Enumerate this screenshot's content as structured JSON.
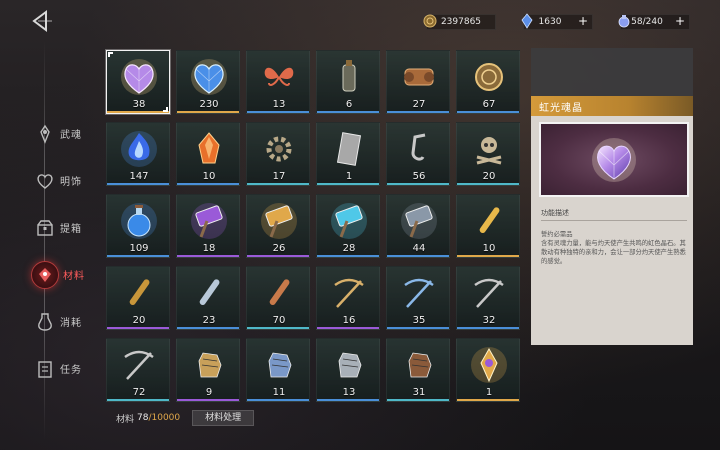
{
  "resources": [
    {
      "icon": "gold-coin-icon",
      "value": "2397865",
      "has_plus": false
    },
    {
      "icon": "blue-crystal-icon",
      "value": "1630",
      "has_plus": true
    },
    {
      "icon": "stamina-potion-icon",
      "value": "58/240",
      "has_plus": true
    }
  ],
  "menu": [
    {
      "label": "武魂",
      "icon": "spirit-icon",
      "active": false
    },
    {
      "label": "明饰",
      "icon": "heart-ornament-icon",
      "active": false
    },
    {
      "label": "提箱",
      "icon": "chest-icon",
      "active": false
    },
    {
      "label": "材料",
      "icon": "material-icon",
      "active": true
    },
    {
      "label": "消耗",
      "icon": "consumable-icon",
      "active": false
    },
    {
      "label": "任务",
      "icon": "quest-icon",
      "active": false
    }
  ],
  "items": [
    {
      "count": "38",
      "icon": "purple-heart-crystal-icon",
      "rarity": "#e0a84a",
      "selected": true
    },
    {
      "count": "230",
      "icon": "blue-heart-crystal-icon",
      "rarity": "#e0a84a"
    },
    {
      "count": "13",
      "icon": "red-butterfly-icon",
      "rarity": "#4a8fd8"
    },
    {
      "count": "6",
      "icon": "bottle-icon",
      "rarity": "#4a8fd8"
    },
    {
      "count": "27",
      "icon": "leather-scroll-icon",
      "rarity": "#4a8fd8"
    },
    {
      "count": "67",
      "icon": "bronze-medal-icon",
      "rarity": "#4a8fd8"
    },
    {
      "count": "147",
      "icon": "blue-flame-icon",
      "rarity": "#4a8fd8"
    },
    {
      "count": "10",
      "icon": "fire-shard-icon",
      "rarity": "#4a8fd8"
    },
    {
      "count": "17",
      "icon": "gear-icon",
      "rarity": "#4fb8c8"
    },
    {
      "count": "1",
      "icon": "metal-plate-icon",
      "rarity": "#4fb8c8"
    },
    {
      "count": "56",
      "icon": "hook-icon",
      "rarity": "#4fb8c8"
    },
    {
      "count": "20",
      "icon": "skull-bones-icon",
      "rarity": "#4fb8c8"
    },
    {
      "count": "109",
      "icon": "blue-potion-icon",
      "rarity": "#4a8fd8"
    },
    {
      "count": "18",
      "icon": "purple-hammer-icon",
      "rarity": "#9a5ad8"
    },
    {
      "count": "26",
      "icon": "gold-hammer-icon",
      "rarity": "#9a5ad8"
    },
    {
      "count": "28",
      "icon": "cyan-hammer-icon",
      "rarity": "#4a8fd8"
    },
    {
      "count": "44",
      "icon": "steel-hammer-icon",
      "rarity": "#4a8fd8"
    },
    {
      "count": "10",
      "icon": "golden-bullet-icon",
      "rarity": "#e0a84a"
    },
    {
      "count": "20",
      "icon": "brass-bullet-icon",
      "rarity": "#9a5ad8"
    },
    {
      "count": "23",
      "icon": "silver-bullet-icon",
      "rarity": "#4a8fd8"
    },
    {
      "count": "70",
      "icon": "copper-bullet-icon",
      "rarity": "#4fb8c8"
    },
    {
      "count": "16",
      "icon": "ornate-crossbow-icon",
      "rarity": "#9a5ad8"
    },
    {
      "count": "35",
      "icon": "blue-crossbow-icon",
      "rarity": "#4a8fd8"
    },
    {
      "count": "32",
      "icon": "steel-crossbow-icon",
      "rarity": "#4a8fd8"
    },
    {
      "count": "72",
      "icon": "silver-crossbow-icon",
      "rarity": "#4fb8c8"
    },
    {
      "count": "9",
      "icon": "gold-gauntlet-icon",
      "rarity": "#9a5ad8"
    },
    {
      "count": "11",
      "icon": "blue-gauntlet-icon",
      "rarity": "#4a8fd8"
    },
    {
      "count": "13",
      "icon": "steel-gauntlet-icon",
      "rarity": "#4a8fd8"
    },
    {
      "count": "31",
      "icon": "leather-gauntlet-icon",
      "rarity": "#4fb8c8"
    },
    {
      "count": "1",
      "icon": "golden-amulet-icon",
      "rarity": "#e0a84a"
    }
  ],
  "footer": {
    "caption": "材料",
    "current": "78",
    "max": "/10000",
    "button": "材料处理"
  },
  "detail": {
    "title": "虹光魂晶",
    "section": "功能描述",
    "desc_1": "誓约必需品",
    "desc_2": "含有灵魂力量，能与灼天使产生共鸣的虹色晶石。其散动有种独特的亲和力，会让一部分灼天使产生熟悉的感觉。"
  }
}
